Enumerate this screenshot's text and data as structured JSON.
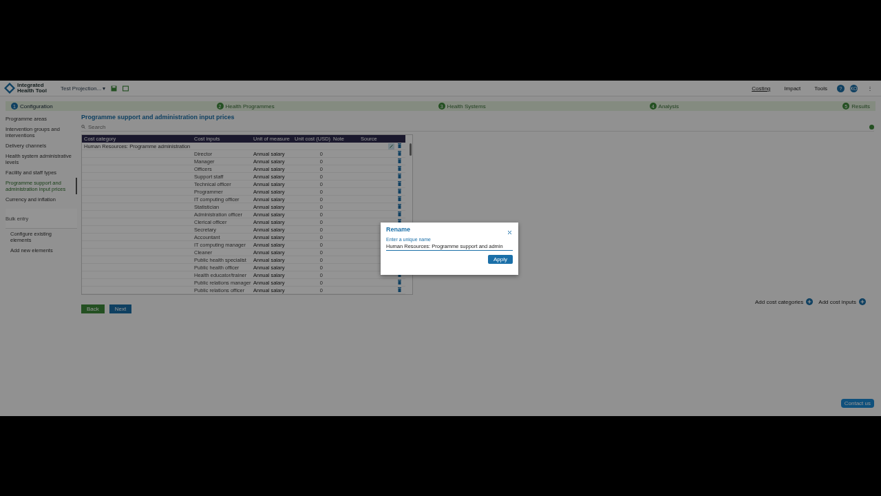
{
  "app": {
    "name_line1": "Integrated",
    "name_line2": "Health Tool",
    "project": "Test Projection...",
    "project_caret": "▾"
  },
  "top_nav": [
    {
      "label": "Costing",
      "selected": true
    },
    {
      "label": "Impact",
      "selected": false
    },
    {
      "label": "Tools",
      "selected": false
    }
  ],
  "user": {
    "help": "?",
    "avatar": "KO",
    "menu": "⋮"
  },
  "steps": [
    {
      "number": "1",
      "label": "Configuration",
      "selected": true
    },
    {
      "number": "2",
      "label": "Health Programmes",
      "selected": false
    },
    {
      "number": "3",
      "label": "Health Systems",
      "selected": false
    },
    {
      "number": "4",
      "label": "Analysis",
      "selected": false
    },
    {
      "number": "5",
      "label": "Results",
      "selected": false
    }
  ],
  "sidebar": {
    "items": [
      {
        "kind": "item",
        "label": "Programme areas",
        "selected": false
      },
      {
        "kind": "item",
        "label": "Intervention groups and interventions",
        "selected": false
      },
      {
        "kind": "item",
        "label": "Delivery channels",
        "selected": false
      },
      {
        "kind": "item",
        "label": "Health system administrative levels",
        "selected": false
      },
      {
        "kind": "item",
        "label": "Facility and staff types",
        "selected": false
      },
      {
        "kind": "item",
        "label": "Programme support and administration input prices",
        "selected": true
      },
      {
        "kind": "item",
        "label": "Currency and inflation",
        "selected": false
      },
      {
        "kind": "header",
        "label": "Bulk entry",
        "selected": false
      },
      {
        "kind": "subitem",
        "label": "Configure existing elements",
        "selected": false
      },
      {
        "kind": "subitem",
        "label": "Add new elements",
        "selected": false
      }
    ]
  },
  "page_title": "Programme support and administration input prices",
  "search": {
    "placeholder": "Search"
  },
  "table": {
    "columns": [
      "Cost category",
      "Cost inputs",
      "Unit of measure",
      "Unit cost (USD)",
      "Note",
      "Source"
    ],
    "category": "Human Resources: Programme administration",
    "rows": [
      {
        "input": "Director",
        "unit": "Annual salary",
        "cost": "0"
      },
      {
        "input": "Manager",
        "unit": "Annual salary",
        "cost": "0"
      },
      {
        "input": "Officers",
        "unit": "Annual salary",
        "cost": "0"
      },
      {
        "input": "Support staff",
        "unit": "Annual salary",
        "cost": "0"
      },
      {
        "input": "Technical officer",
        "unit": "Annual salary",
        "cost": "0"
      },
      {
        "input": "Programmer",
        "unit": "Annual salary",
        "cost": "0"
      },
      {
        "input": "IT computing officer",
        "unit": "Annual salary",
        "cost": "0"
      },
      {
        "input": "Statistician",
        "unit": "Annual salary",
        "cost": "0"
      },
      {
        "input": "Administration officer",
        "unit": "Annual salary",
        "cost": "0"
      },
      {
        "input": "Clerical officer",
        "unit": "Annual salary",
        "cost": "0"
      },
      {
        "input": "Secretary",
        "unit": "Annual salary",
        "cost": "0"
      },
      {
        "input": "Accountant",
        "unit": "Annual salary",
        "cost": "0"
      },
      {
        "input": "IT computing manager",
        "unit": "Annual salary",
        "cost": "0"
      },
      {
        "input": "Cleaner",
        "unit": "Annual salary",
        "cost": "0"
      },
      {
        "input": "Public health specialist",
        "unit": "Annual salary",
        "cost": "0"
      },
      {
        "input": "Public health officer",
        "unit": "Annual salary",
        "cost": "0"
      },
      {
        "input": "Health educator/trainer",
        "unit": "Annual salary",
        "cost": "0"
      },
      {
        "input": "Public relations manager",
        "unit": "Annual salary",
        "cost": "0"
      },
      {
        "input": "Public relations officer",
        "unit": "Annual salary",
        "cost": "0"
      }
    ]
  },
  "buttons": {
    "back": "Back",
    "next": "Next",
    "add_categories": "Add cost categories",
    "add_inputs": "Add cost inputs",
    "contact": "Contact us"
  },
  "dialog": {
    "title": "Rename",
    "field_label": "Enter a unique name",
    "value": "Human Resources: Programme support and admin",
    "apply": "Apply"
  }
}
